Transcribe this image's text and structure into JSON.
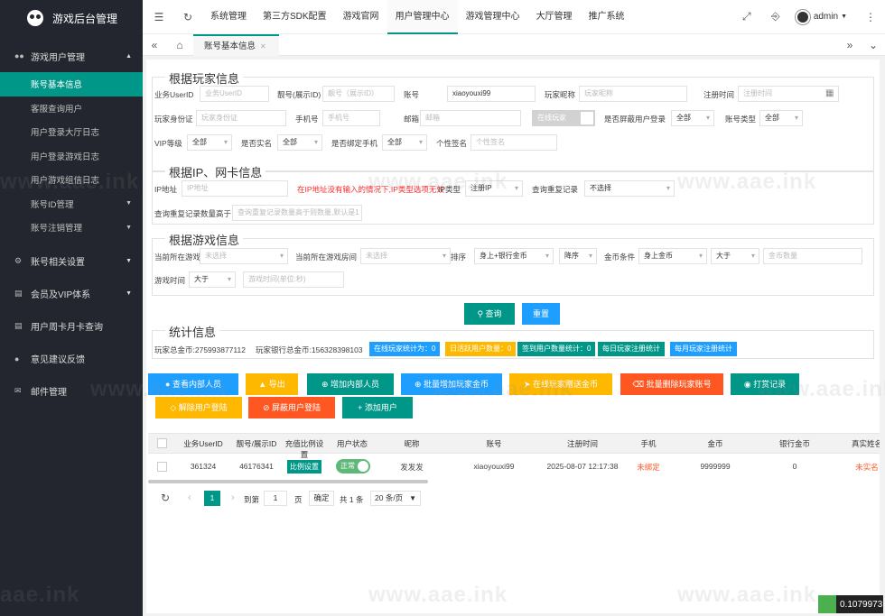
{
  "app": {
    "title": "游戏后台管理"
  },
  "sidebar": {
    "groups": [
      {
        "label": "游戏用户管理",
        "icon": "users-icon"
      },
      {
        "label": "账号相关设置",
        "icon": "gear-icon"
      },
      {
        "label": "会员及VIP体系",
        "icon": "card-icon"
      },
      {
        "label": "用户周卡月卡查询",
        "icon": "card-icon"
      },
      {
        "label": "意见建议反馈",
        "icon": "chat-icon"
      },
      {
        "label": "邮件管理",
        "icon": "mail-icon"
      }
    ],
    "items": [
      {
        "label": "账号基本信息"
      },
      {
        "label": "客服查询用户"
      },
      {
        "label": "用户登录大厅日志"
      },
      {
        "label": "用户登录游戏日志"
      },
      {
        "label": "用户游戏组信日志"
      },
      {
        "label": "账号ID管理"
      },
      {
        "label": "账号注销管理"
      }
    ]
  },
  "topnav": {
    "items": [
      "系统管理",
      "第三方SDK配置",
      "游戏官网",
      "用户管理中心",
      "游戏管理中心",
      "大厅管理",
      "推广系统"
    ],
    "user": "admin"
  },
  "tabs": {
    "current": "账号基本信息"
  },
  "player": {
    "legend": "根据玩家信息",
    "userid_label": "业务UserID",
    "userid_ph": "业务UserID",
    "nick_label": "靓号(展示ID)",
    "nick_ph": "靓号（展示ID）",
    "account_label": "账号",
    "account_value": "xiaoyouxi99",
    "nickname_label": "玩家昵称",
    "nickname_ph": "玩家昵称",
    "regtime_label": "注册时间",
    "regtime_ph": "注册时间",
    "idcard_label": "玩家身份证",
    "idcard_ph": "玩家身份证",
    "phone_label": "手机号",
    "phone_ph": "手机号",
    "email_label": "邮箱",
    "email_ph": "邮箱",
    "online_toggle": "在线玩家",
    "shield_label": "是否屏蔽用户登录",
    "shield_value": "全部",
    "acctype_label": "账号类型",
    "acctype_value": "全部",
    "vip_label": "VIP等级",
    "vip_value": "全部",
    "realname_label": "是否实名",
    "realname_value": "全部",
    "bindphone_label": "是否绑定手机",
    "bindphone_value": "全部",
    "sign_label": "个性签名",
    "sign_ph": "个性签名"
  },
  "ip": {
    "legend": "根据IP、网卡信息",
    "ip_label": "IP地址",
    "ip_ph": "IP地址",
    "warning": "在IP地址没有输入的情况下,IP类型选项无效",
    "iptype_label": "IP类型",
    "iptype_value": "注册IP",
    "repeat_label": "查询重复记录",
    "repeat_value": "不选择",
    "count_label": "查询重复记录数量高于",
    "count_ph": "查询重复记录数量高于则数量,默认是1"
  },
  "game": {
    "legend": "根据游戏信息",
    "curgame_label": "当前所在游戏",
    "curgame_value": "未选择",
    "curroom_label": "当前所在游戏房间",
    "curroom_value": "未选择",
    "sort_label": "排序",
    "sort_value": "身上+银行金币",
    "order_value": "降序",
    "gold_label": "金币条件",
    "gold_field": "身上金币",
    "gold_op": "大于",
    "gold_ph": "金币数量",
    "time_label": "游戏时间",
    "time_op": "大于",
    "time_ph": "游戏时间(单位:秒)"
  },
  "actions": {
    "query": "查询",
    "reset": "重置"
  },
  "stats": {
    "legend": "统计信息",
    "total_gold": "玩家总金币:275993877112",
    "bank_gold": "玩家银行总金币:156328398103",
    "badges": [
      "在线玩家统计为：0",
      "日活跃用户数量：0",
      "签到用户数量统计：0",
      "每日玩家注册统计",
      "每月玩家注册统计"
    ]
  },
  "toolbar": {
    "buttons": [
      "查看内部人员",
      "导出",
      "增加内部人员",
      "批量增加玩家金币",
      "在线玩家赠送金币",
      "批量删除玩家账号",
      "打赏记录",
      "解除用户登陆",
      "屏蔽用户登陆",
      "添加用户"
    ],
    "colors": [
      "#1e9fff",
      "#ffb800",
      "#009688",
      "#1e9fff",
      "#ffb800",
      "#ff5722",
      "#009688",
      "#ffb800",
      "#ff5722",
      "#009688"
    ]
  },
  "table": {
    "headers": [
      "业务UserID",
      "靓号/展示ID",
      "充值比例设置",
      "用户状态",
      "昵称",
      "账号",
      "注册时间",
      "手机",
      "金币",
      "银行金币",
      "真实姓名"
    ],
    "rows": [
      {
        "userid": "361324",
        "showid": "46176341",
        "ratio_btn": "比例设置",
        "status": "正常",
        "nickname": "发发发",
        "account": "xiaoyouxi99",
        "regtime": "2025-08-07 12:17:38",
        "phone": "未绑定",
        "gold": "9999999",
        "bank": "0",
        "realname": "未实名"
      }
    ]
  },
  "pager": {
    "current": "1",
    "goto_label": "到第",
    "goto_value": "1",
    "page_unit": "页",
    "confirm": "确定",
    "total": "共 1 条",
    "size": "20 条/页"
  },
  "footer_badge": "0.1079973",
  "watermark": "www.aae.ink",
  "watermark_short": "aae.ink"
}
